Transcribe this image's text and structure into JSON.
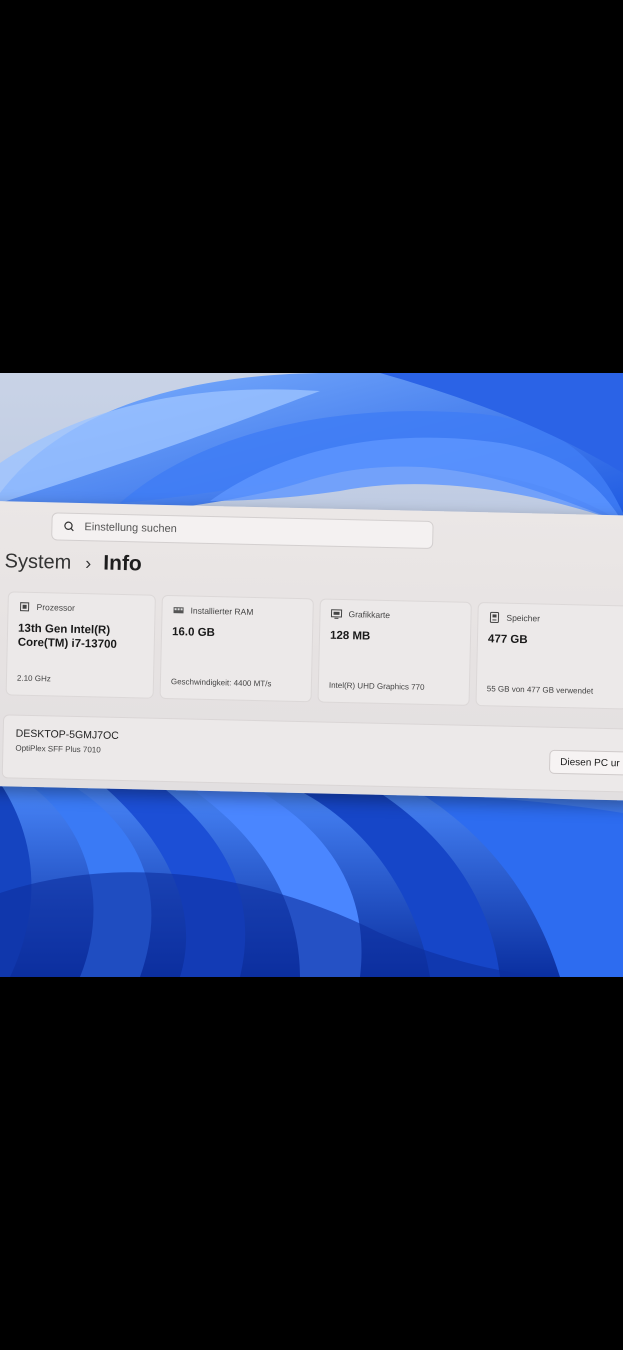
{
  "search": {
    "placeholder": "Einstellung suchen",
    "icon": "search-icon"
  },
  "breadcrumb": {
    "parent": "System",
    "separator": "›",
    "current": "Info"
  },
  "cards": {
    "processor": {
      "label": "Prozessor",
      "line1": "13th Gen Intel(R)",
      "line2": "Core(TM) i7-13700",
      "foot": "2.10 GHz",
      "icon": "processor-icon"
    },
    "ram": {
      "label": "Installierter RAM",
      "line1": "16.0 GB",
      "foot": "Geschwindigkeit: 4400 MT/s",
      "icon": "ram-icon"
    },
    "gpu": {
      "label": "Grafikkarte",
      "line1": "128 MB",
      "foot": "Intel(R) UHD Graphics 770",
      "icon": "gpu-icon"
    },
    "storage": {
      "label": "Speicher",
      "line1": "477 GB",
      "foot": "55 GB von 477 GB verwendet",
      "icon": "storage-icon"
    }
  },
  "device": {
    "name": "DESKTOP-5GMJ7OC",
    "model": "OptiPlex SFF Plus 7010",
    "rename_button": "Diesen PC ur"
  },
  "colors": {
    "wallpaper_blue": "#1a4fd0",
    "window_bg": "#ebe7e6",
    "frame": "#000000"
  }
}
